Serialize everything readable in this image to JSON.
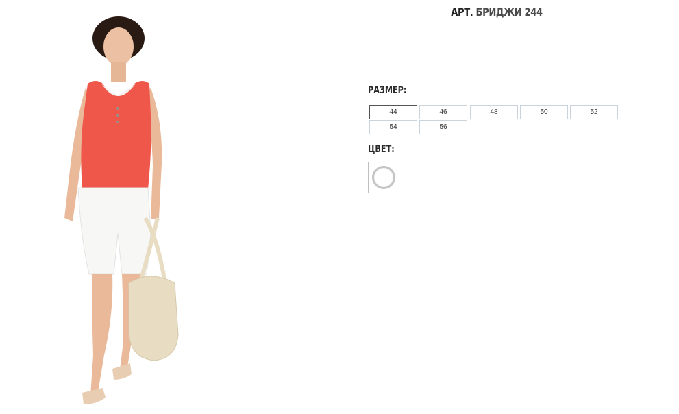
{
  "product": {
    "title_prefix": "АРТ.",
    "title_name": "БРИДЖИ 244",
    "size_label": "РАЗМЕР:",
    "color_label": "ЦВЕТ:",
    "selected_size": "44",
    "sizes": [
      "44",
      "46",
      "48",
      "50",
      "52",
      "54",
      "56"
    ],
    "colors": [
      {
        "name": "white-swatch",
        "hex": "#ffffff"
      }
    ]
  },
  "palette": {
    "top_coral": "#f0574b",
    "shorts_white": "#f7f7f5",
    "bag_beige": "#e8dcc2",
    "skin": "#e9b99a",
    "hair": "#2a1a14"
  }
}
